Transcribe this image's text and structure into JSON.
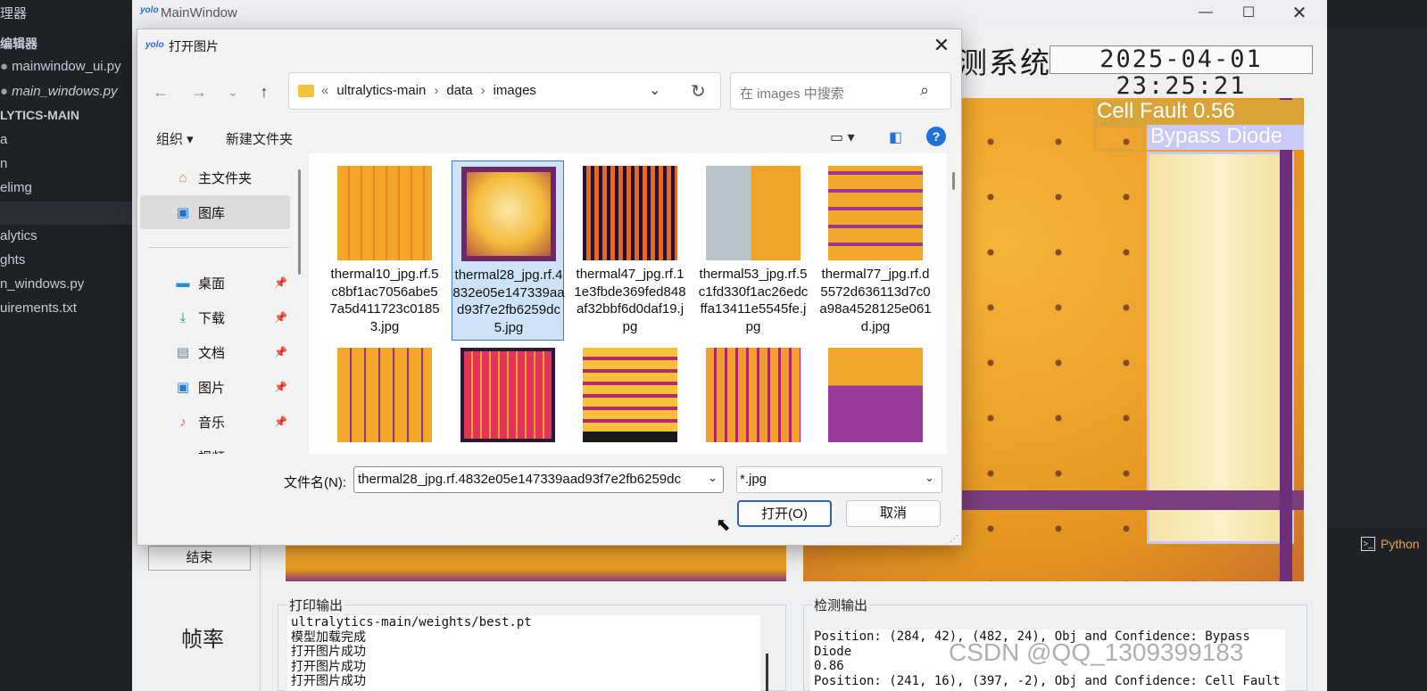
{
  "vscode": {
    "explorer_title": "理器",
    "editors_header": "编辑器",
    "open_editors": [
      "mainwindow_ui.py",
      "main_windows.py"
    ],
    "project_header": "LYTICS-MAIN",
    "tree": [
      "a",
      "n",
      "elimg",
      "alytics",
      "ghts",
      "n_windows.py",
      "uirements.txt"
    ],
    "terminal_tab": "Python"
  },
  "mainwindow": {
    "app_logo": "yolo",
    "title": "MainWindow",
    "system_title_suffix": "测系统",
    "clock": "2025-04-01 23:25:21",
    "end_button": "结束",
    "fps_label": "帧率",
    "print_output_title": "打印输出",
    "print_output_lines": [
      "ultralytics-main/weights/best.pt",
      "模型加载完成",
      "打开图片成功",
      "打开图片成功",
      "打开图片成功"
    ],
    "detect_output_title": "检测输出",
    "detect_output_lines": [
      "Position: (284, 42), (482, 24), Obj and Confidence: Bypass Diode",
      "0.86",
      "Position: (241, 16), (397, -2), Obj and Confidence: Cell Fault"
    ],
    "detection_labels": [
      "Cell Fault 0.56",
      "Bypass Diode"
    ],
    "watermark": "CSDN @QQ_1309399183"
  },
  "dialog": {
    "logo": "yolo",
    "title": "打开图片",
    "breadcrumb": [
      "ultralytics-main",
      "data",
      "images"
    ],
    "search_placeholder": "在 images 中搜索",
    "organize": "组织 ▾",
    "new_folder": "新建文件夹",
    "nav": [
      {
        "label": "主文件夹",
        "icon": "home-icon"
      },
      {
        "label": "图库",
        "icon": "gallery-icon"
      },
      {
        "label": "桌面",
        "icon": "desktop-icon"
      },
      {
        "label": "下载",
        "icon": "download-icon"
      },
      {
        "label": "文档",
        "icon": "document-icon"
      },
      {
        "label": "图片",
        "icon": "pictures-icon"
      },
      {
        "label": "音乐",
        "icon": "music-icon"
      },
      {
        "label": "视频",
        "icon": "video-icon"
      }
    ],
    "files": [
      {
        "name": "thermal10_jpg.rf.5c8bf1ac7056abe57a5d411723c01853.jpg",
        "selected": false
      },
      {
        "name": "thermal28_jpg.rf.4832e05e147339aad93f7e2fb6259dc5.jpg",
        "selected": true
      },
      {
        "name": "thermal47_jpg.rf.11e3fbde369fed848af32bbf6d0daf19.jpg",
        "selected": false
      },
      {
        "name": "thermal53_jpg.rf.5c1fd330f1ac26edcffa13411e5545fe.jpg",
        "selected": false
      },
      {
        "name": "thermal77_jpg.rf.d5572d636113d7c0a98a4528125e061d.jpg",
        "selected": false
      }
    ],
    "filename_label": "文件名(N):",
    "filename_value": "thermal28_jpg.rf.4832e05e147339aad93f7e2fb6259dc",
    "filetype_value": "*.jpg",
    "open_button": "打开(O)",
    "cancel_button": "取消"
  },
  "colors": {
    "accent": "#1f73d8",
    "selection": "#cfe3f8",
    "selection_border": "#3a78c4",
    "thermal_orange": "#f2a62a",
    "thermal_purple": "#7a2f7d"
  }
}
